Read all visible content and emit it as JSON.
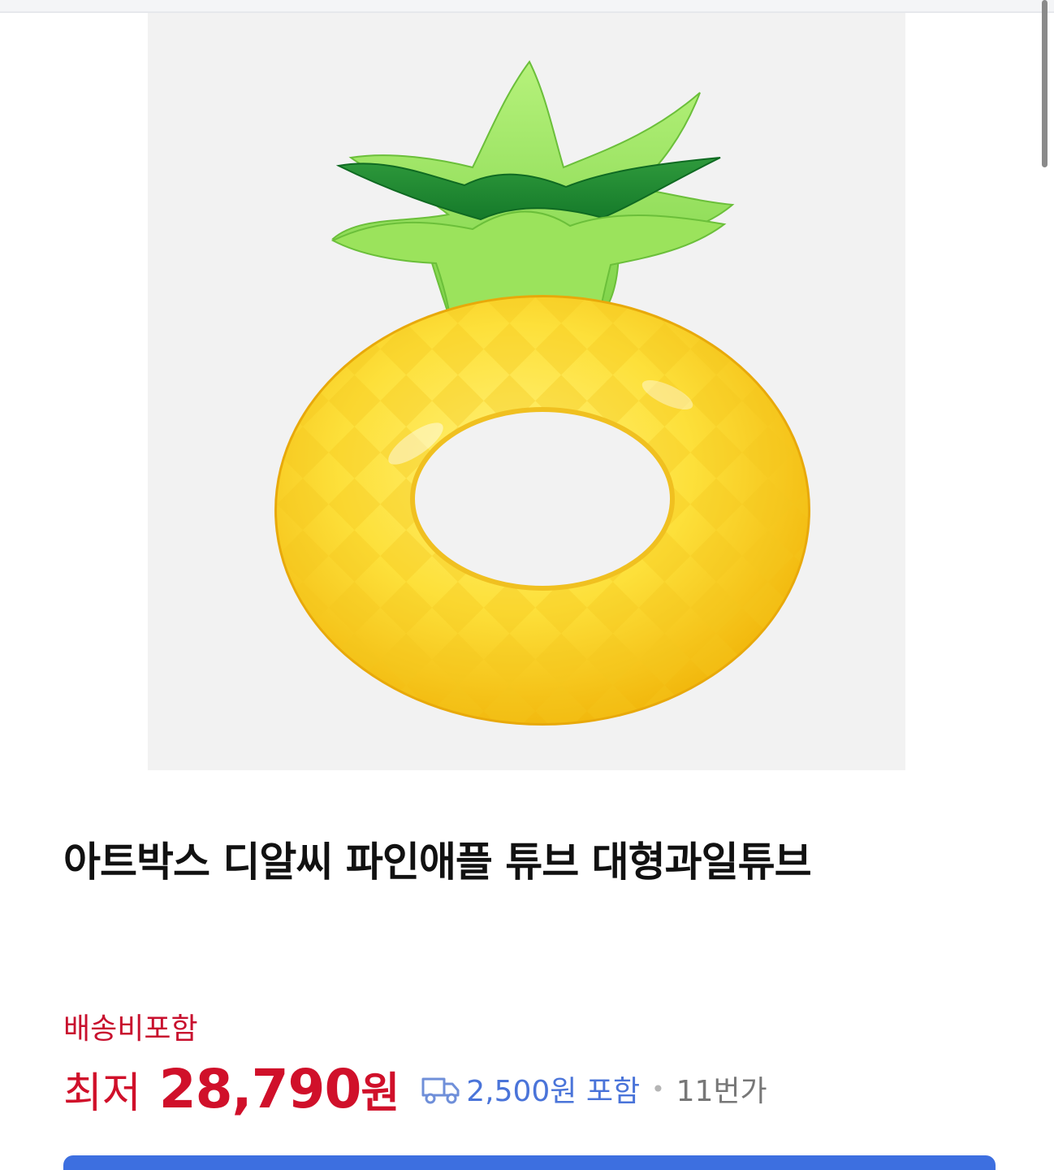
{
  "product": {
    "image_alt": "pineapple-float-image",
    "title": "아트박스 디알씨 파인애플 튜브 대형과일튜브",
    "shipping_note": "배송비포함",
    "price_prefix": "최저",
    "price_amount": "28,790",
    "price_unit": "원",
    "delivery_fee": "2,500원 포함",
    "separator": "•",
    "seller": "11번가"
  },
  "icons": {
    "zoom": "expand-arrows-icon",
    "delivery": "truck-icon"
  },
  "colors": {
    "price": "#d0102a",
    "shipping_note": "#c8102e",
    "delivery": "#4a74d9",
    "accent_button": "#3d6fe0"
  }
}
